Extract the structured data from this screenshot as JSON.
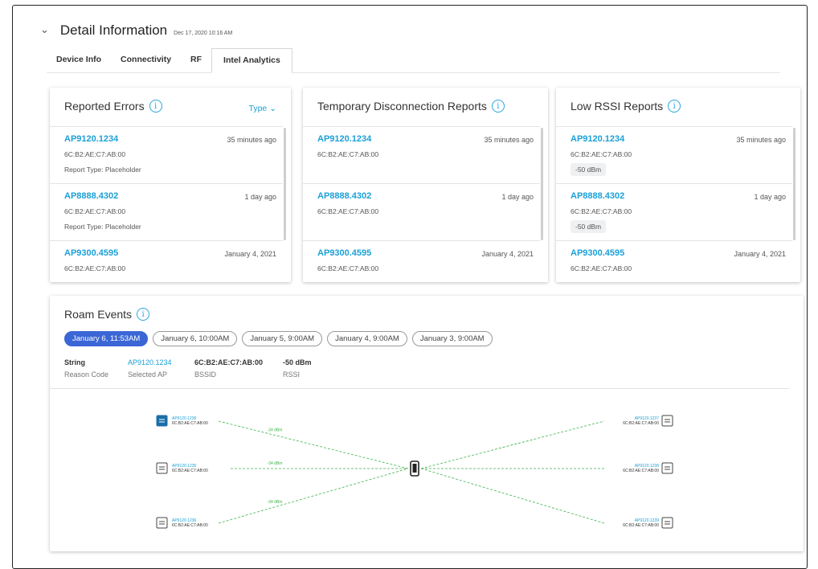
{
  "header": {
    "title": "Detail Information",
    "timestamp": "Dec 17, 2020 10:16 AM"
  },
  "tabs": [
    "Device Info",
    "Connectivity",
    "RF",
    "Intel Analytics"
  ],
  "active_tab": "Intel Analytics",
  "cards": {
    "errors": {
      "title": "Reported Errors",
      "type_label": "Type",
      "items": [
        {
          "ap": "AP9120.1234",
          "time": "35 minutes ago",
          "mac": "6C:B2:AE:C7:AB:00",
          "extra": "Report Type: Placeholder"
        },
        {
          "ap": "AP8888.4302",
          "time": "1 day ago",
          "mac": "6C:B2:AE:C7:AB:00",
          "extra": "Report Type: Placeholder"
        },
        {
          "ap": "AP9300.4595",
          "time": "January 4, 2021",
          "mac": "6C:B2:AE:C7:AB:00"
        }
      ]
    },
    "disconnect": {
      "title": "Temporary Disconnection Reports",
      "items": [
        {
          "ap": "AP9120.1234",
          "time": "35 minutes ago",
          "mac": "6C:B2:AE:C7:AB:00"
        },
        {
          "ap": "AP8888.4302",
          "time": "1 day ago",
          "mac": "6C:B2:AE:C7:AB:00"
        },
        {
          "ap": "AP9300.4595",
          "time": "January 4, 2021",
          "mac": "6C:B2:AE:C7:AB:00"
        }
      ]
    },
    "rssi": {
      "title": "Low RSSI Reports",
      "items": [
        {
          "ap": "AP9120.1234",
          "time": "35 minutes ago",
          "mac": "6C:B2:AE:C7:AB:00",
          "pill": "-50 dBm"
        },
        {
          "ap": "AP8888.4302",
          "time": "1 day ago",
          "mac": "6C:B2:AE:C7:AB:00",
          "pill": "-50 dBm"
        },
        {
          "ap": "AP9300.4595",
          "time": "January 4, 2021",
          "mac": "6C:B2:AE:C7:AB:00"
        }
      ]
    }
  },
  "roam": {
    "title": "Roam Events",
    "dates": [
      "January 6, 11:53AM",
      "January 6, 10:00AM",
      "January 5, 9:00AM",
      "January 4, 9:00AM",
      "January 3, 9:00AM"
    ],
    "selected_date": "January 6, 11:53AM",
    "details": [
      {
        "value": "String",
        "label": "Reason Code"
      },
      {
        "value": "AP9120.1234",
        "label": "Selected AP",
        "link": true
      },
      {
        "value": "6C:B2:AE:C7:AB:00",
        "label": "BSSID"
      },
      {
        "value": "-50 dBm",
        "label": "RSSI"
      }
    ],
    "left_aps": [
      {
        "name": "AP9120.1236",
        "mac": "6C:B2:AE:C7:AB:00",
        "rssi": "-34 dBm",
        "selected": true
      },
      {
        "name": "AP9120.1235",
        "mac": "6C:B2:AE:C7:AB:00",
        "rssi": "-34 dBm"
      },
      {
        "name": "AP9120.1236",
        "mac": "6C:B2:AE:C7:AB:00",
        "rssi": "-34 dBm"
      }
    ],
    "right_aps": [
      {
        "name": "AP9120.1237",
        "mac": "6C:B2:AE:C7:AB:00"
      },
      {
        "name": "AP9120.1238",
        "mac": "6C:B2:AE:C7:AB:00"
      },
      {
        "name": "AP9120.1239",
        "mac": "6C:B2:AE:C7:AB:00"
      }
    ]
  },
  "colors": {
    "accent": "#1ba0d8",
    "selected_pill": "#3b66d6",
    "link_line": "#3cb44b"
  }
}
